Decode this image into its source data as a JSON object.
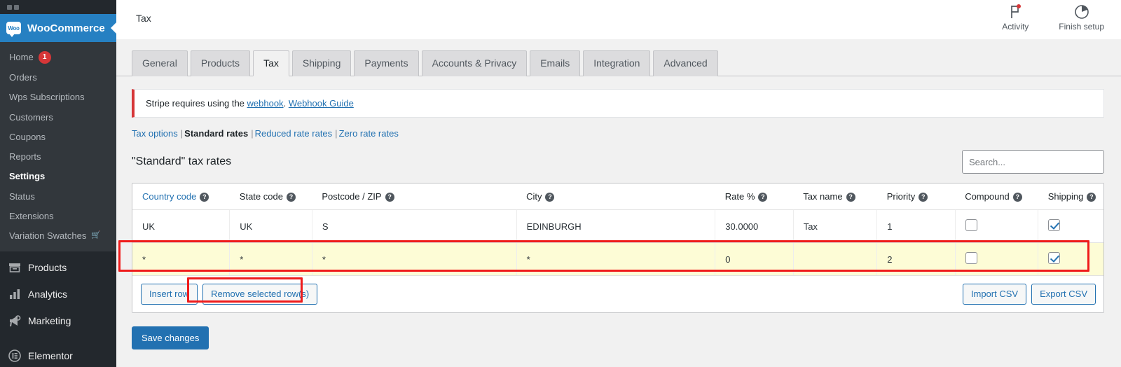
{
  "sidebar": {
    "brand": {
      "label": "WooCommerce",
      "logo_text": "Woo",
      "accent": "#2680c2"
    },
    "submenu": [
      {
        "label": "Home",
        "badge": "1",
        "active": false
      },
      {
        "label": "Orders",
        "active": false
      },
      {
        "label": "Wps Subscriptions",
        "active": false
      },
      {
        "label": "Customers",
        "active": false
      },
      {
        "label": "Coupons",
        "active": false
      },
      {
        "label": "Reports",
        "active": false
      },
      {
        "label": "Settings",
        "active": true
      },
      {
        "label": "Status",
        "active": false
      },
      {
        "label": "Extensions",
        "active": false
      },
      {
        "label": "Variation Swatches",
        "icon": "cart-icon",
        "active": false
      }
    ],
    "mainmenu": [
      {
        "label": "Products",
        "icon": "products-icon"
      },
      {
        "label": "Analytics",
        "icon": "analytics-icon"
      },
      {
        "label": "Marketing",
        "icon": "megaphone-icon"
      },
      {
        "label": "Elementor",
        "icon": "elementor-icon"
      }
    ]
  },
  "topbar": {
    "title": "Tax",
    "actions": [
      {
        "label": "Activity",
        "icon": "flag-icon",
        "dot_color": "#d63638"
      },
      {
        "label": "Finish setup",
        "icon": "progress-pie-icon"
      }
    ]
  },
  "tabs": [
    {
      "label": "General",
      "active": false
    },
    {
      "label": "Products",
      "active": false
    },
    {
      "label": "Tax",
      "active": true
    },
    {
      "label": "Shipping",
      "active": false
    },
    {
      "label": "Payments",
      "active": false
    },
    {
      "label": "Accounts & Privacy",
      "active": false
    },
    {
      "label": "Emails",
      "active": false
    },
    {
      "label": "Integration",
      "active": false
    },
    {
      "label": "Advanced",
      "active": false
    }
  ],
  "notice": {
    "text_before": "Stripe requires using the ",
    "link1": "webhook",
    "text_middle": ". ",
    "link2": "Webhook Guide",
    "accent": "#d63638"
  },
  "subnav": {
    "items": [
      {
        "label": "Tax options",
        "active": false
      },
      {
        "label": "Standard rates",
        "active": true
      },
      {
        "label": "Reduced rate rates",
        "active": false
      },
      {
        "label": "Zero rate rates",
        "active": false
      }
    ],
    "separator": "|"
  },
  "section": {
    "title": "\"Standard\" tax rates",
    "search_placeholder": "Search...",
    "search_value": ""
  },
  "table": {
    "columns": [
      {
        "label": "Country code",
        "help": "?",
        "is_link": true
      },
      {
        "label": "State code",
        "help": "?",
        "is_link": false
      },
      {
        "label": "Postcode / ZIP",
        "help": "?",
        "is_link": false
      },
      {
        "label": "City",
        "help": "?",
        "is_link": false
      },
      {
        "label": "Rate %",
        "help": "?",
        "is_link": false
      },
      {
        "label": "Tax name",
        "help": "?",
        "is_link": false
      },
      {
        "label": "Priority",
        "help": "?",
        "is_link": false
      },
      {
        "label": "Compound",
        "help": "?",
        "is_link": false
      },
      {
        "label": "Shipping",
        "help": "?",
        "is_link": false
      }
    ],
    "rows": [
      {
        "highlighted": false,
        "country_code": "UK",
        "state_code": "UK",
        "postcode": "S",
        "city": "EDINBURGH",
        "rate": "30.0000",
        "tax_name": "Tax",
        "priority": "1",
        "compound": false,
        "shipping": true
      },
      {
        "highlighted": true,
        "country_code": "*",
        "state_code": "*",
        "postcode": "*",
        "city": "*",
        "rate": "0",
        "tax_name": "",
        "priority": "2",
        "compound": false,
        "shipping": true
      }
    ]
  },
  "footer_buttons": {
    "insert_row": "Insert row",
    "remove_rows": "Remove selected row(s)",
    "import_csv": "Import CSV",
    "export_csv": "Export CSV"
  },
  "save": {
    "label": "Save changes",
    "color": "#2271b1"
  },
  "annotations": {
    "color": "#ef1b1b"
  }
}
